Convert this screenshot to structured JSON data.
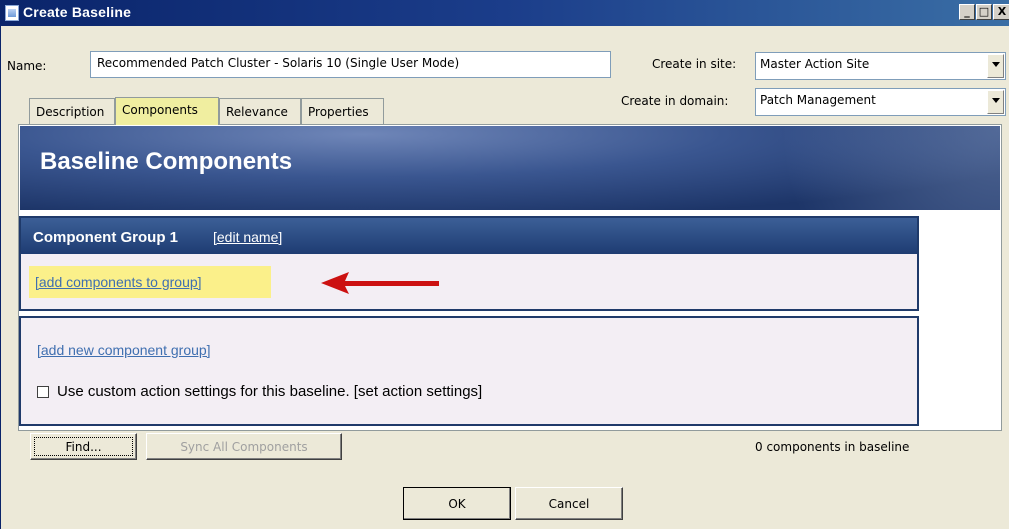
{
  "window": {
    "title": "Create Baseline",
    "controls": [
      "_",
      "□",
      "X"
    ]
  },
  "form": {
    "name_label": "Name:",
    "name_value": "Recommended Patch Cluster - Solaris 10 (Single User Mode)",
    "site_label": "Create in site:",
    "site_value": "Master Action Site",
    "domain_label": "Create in domain:",
    "domain_value": "Patch Management"
  },
  "tabs": [
    {
      "label": "Description"
    },
    {
      "label": "Components",
      "active": true
    },
    {
      "label": "Relevance"
    },
    {
      "label": "Properties"
    }
  ],
  "panel": {
    "banner_title": "Baseline Components",
    "group": {
      "name": "Component Group 1",
      "edit_link": "[edit name]",
      "add_link": "[add components to group]"
    },
    "add_group_link": "[add new component group]",
    "custom_action_label": "Use custom action settings for this baseline. [set action settings]",
    "custom_action_checked": false
  },
  "bottom": {
    "find_label": "Find...",
    "sync_label": "Sync All Components",
    "count_text": "0 components in baseline"
  },
  "dialog_buttons": {
    "ok": "OK",
    "cancel": "Cancel"
  },
  "colors": {
    "titlebar": "#0a246a",
    "active_tab": "#f0eea0",
    "highlight": "#fbf08a",
    "link": "#3f6fb0",
    "annotation_arrow": "#cc1111"
  }
}
